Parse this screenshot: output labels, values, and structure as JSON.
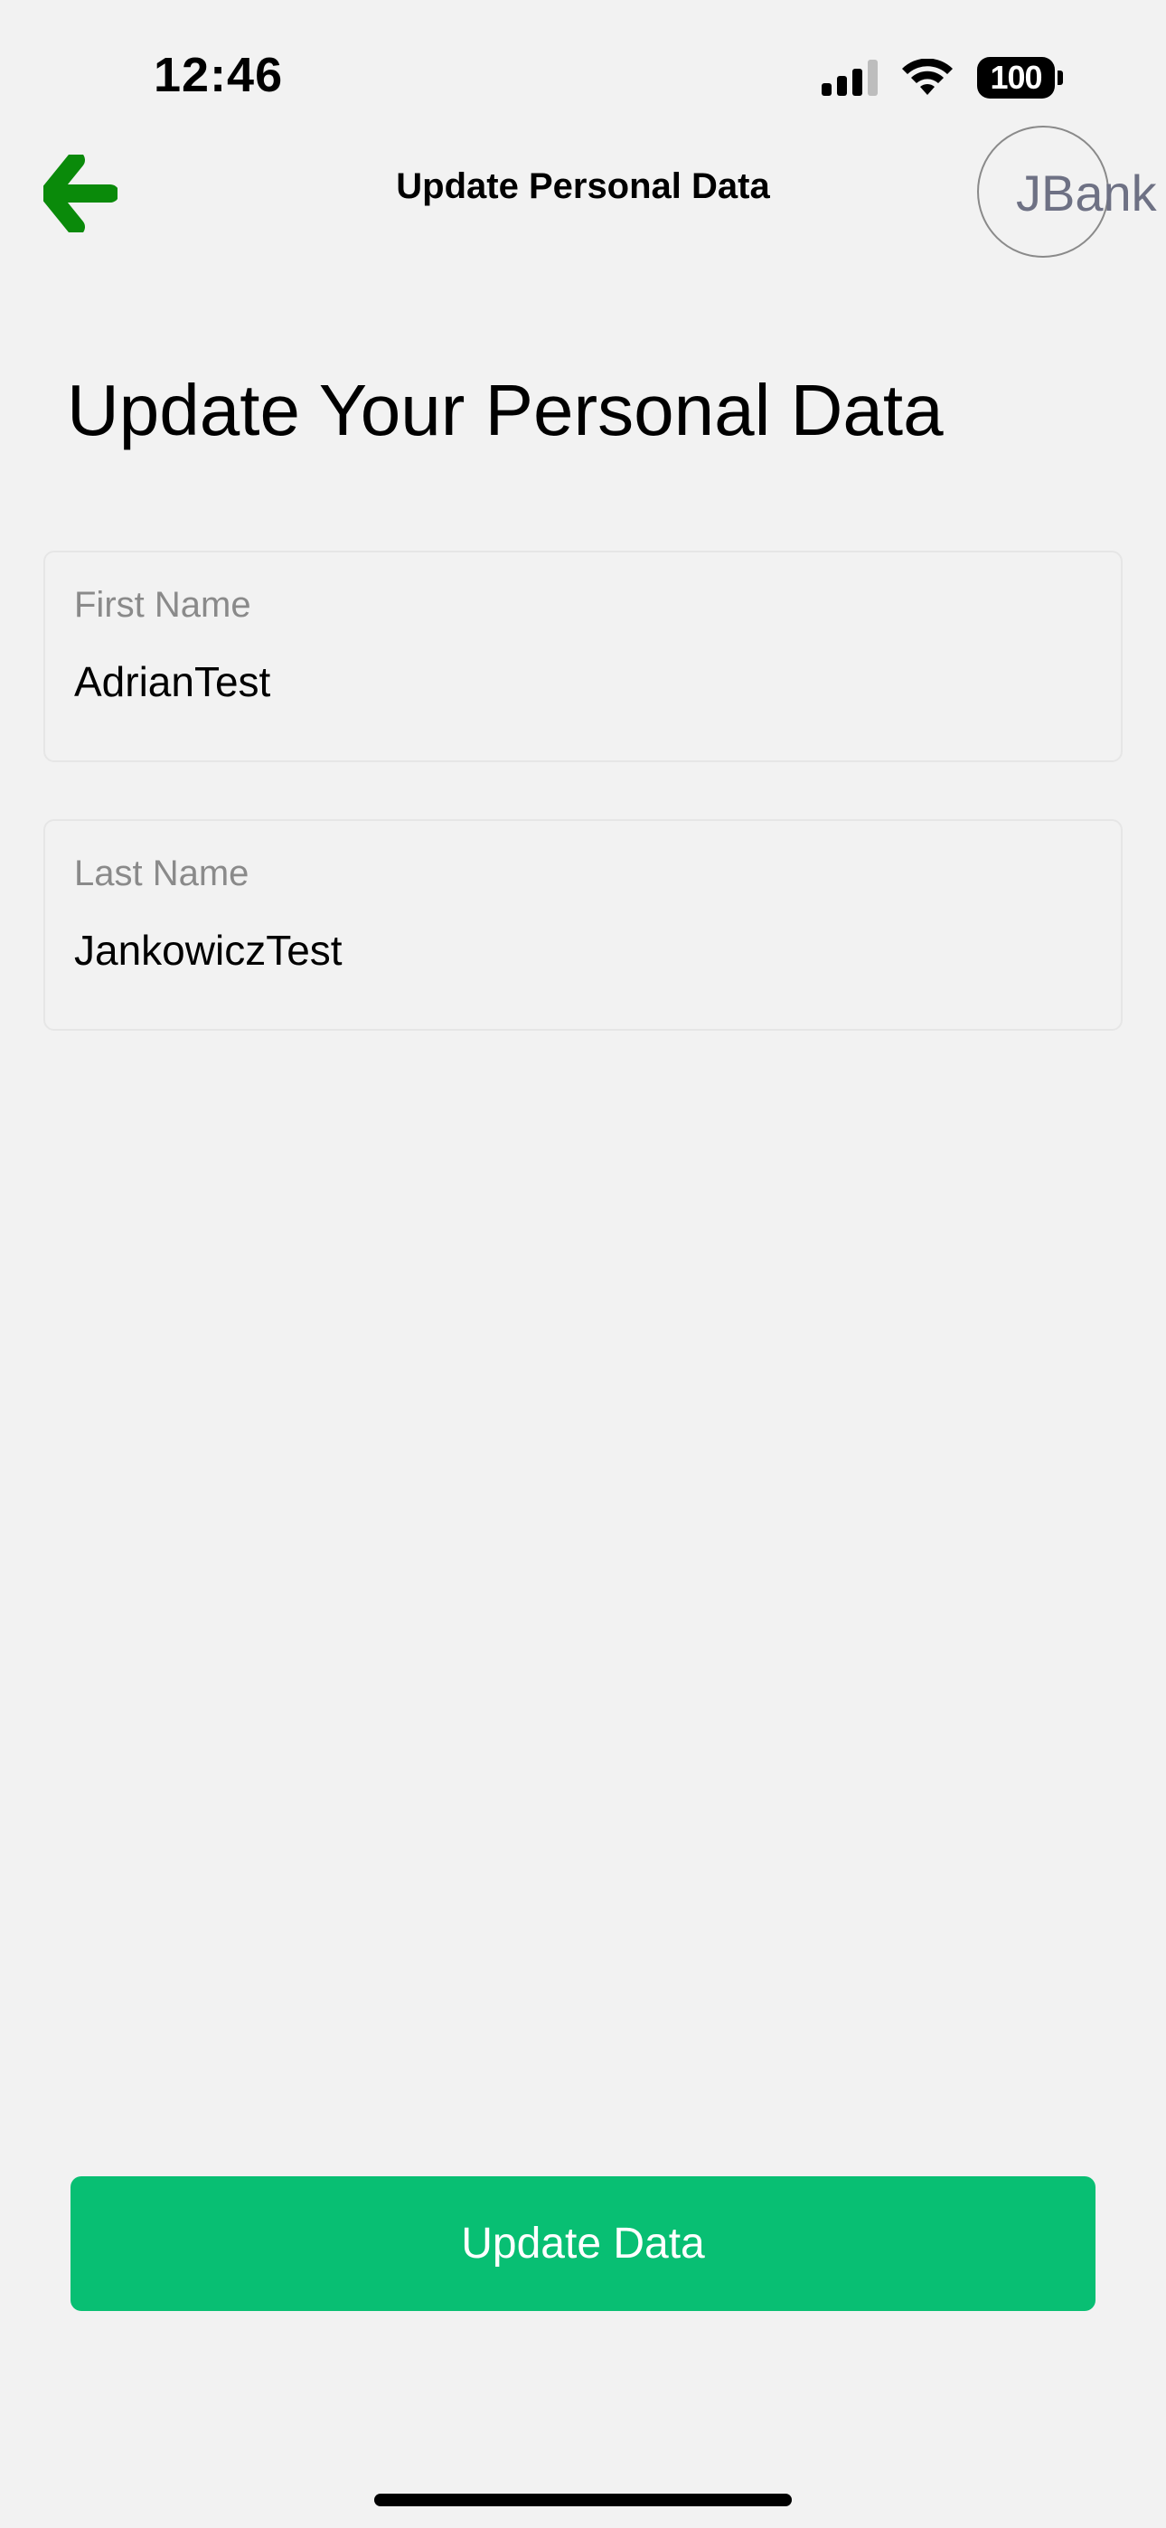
{
  "status_bar": {
    "time": "12:46",
    "battery": "100",
    "signal_icon": "cellular-signal-icon",
    "wifi_icon": "wifi-icon"
  },
  "nav": {
    "back_icon": "arrow-left-icon",
    "title": "Update Personal Data",
    "logo_text": "JBank",
    "accent_color": "#0a8a0a"
  },
  "page": {
    "heading": "Update Your Personal Data"
  },
  "form": {
    "first_name": {
      "label": "First Name",
      "value": "AdrianTest"
    },
    "last_name": {
      "label": "Last Name",
      "value": "JankowiczTest"
    }
  },
  "actions": {
    "update_label": "Update Data",
    "button_color": "#08bf73"
  }
}
